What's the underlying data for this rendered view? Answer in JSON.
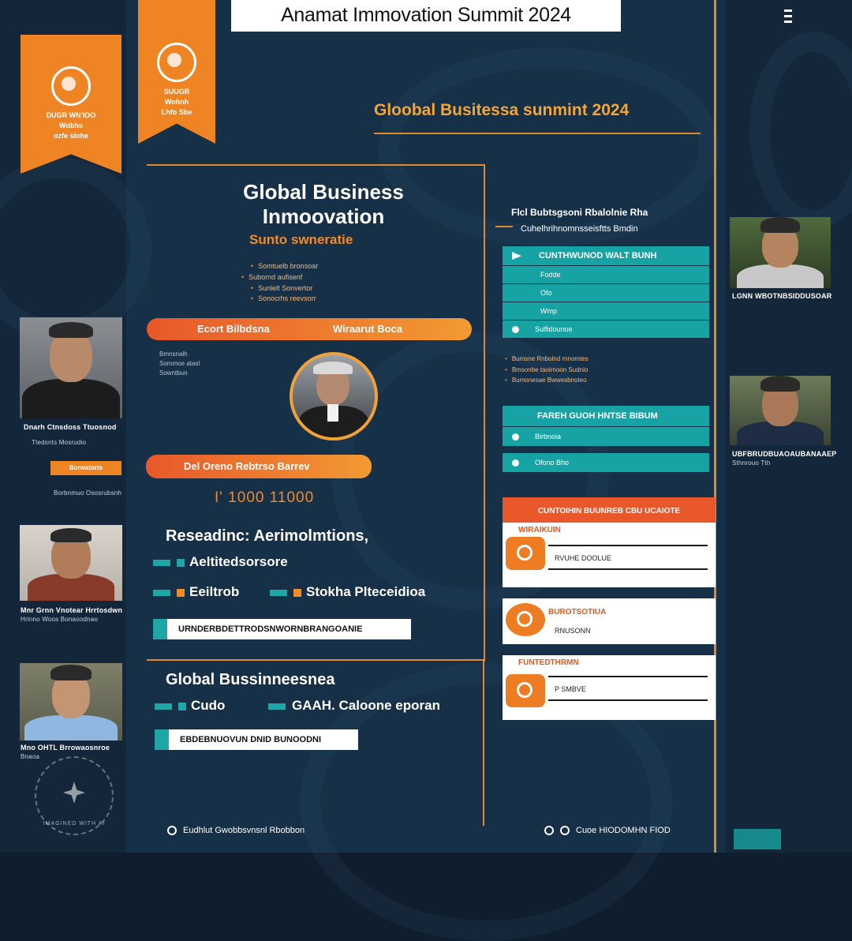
{
  "header": {
    "title": "Anamat Immovation Summit 2024"
  },
  "subtitle": "Gloobal Busitessa sunmint 2024",
  "left_ribbon": {
    "lines": [
      "DUGR WN'IOO",
      "Wdbhs",
      "ozfe   slohe"
    ]
  },
  "top_ribbon": {
    "lines": [
      "SUUGR",
      "Wohnh",
      "Lhfo     Sbe"
    ]
  },
  "main_panel": {
    "title_line1": "Global Business",
    "title_line2": "Inmoovation",
    "tagline": "Sunto swneratie",
    "bullets": [
      "Somtuelb bronsoar",
      "Subornd aufisenf",
      "Sunlelt Sonvertor",
      "Sonocrhs reevsorr"
    ],
    "pill1_left": "Ecort Bilbdsna",
    "pill1_right": "Wiraarut Boca",
    "small_left_lines": [
      "Bmnsnalh",
      "Sommoe atasl",
      "Sowntbun"
    ],
    "pill2": "Del Oreno Rebtrso Barrev",
    "date": "I' 1000 11000",
    "research_heading": "Reseadinc: Aerimolmtions,",
    "tag_arch": "Aeltitedsorsore",
    "tag_estab": "Eeiltrob",
    "tag_stakh": "Stokha Plteceidioa",
    "cta1": "URNDERBDETTRODSNWORNBRANGOANIE",
    "section2_heading": "Global Bussinneesnea",
    "tag_cudo": "Cudo",
    "tag_gaai": "GAAH. Caloone eporan",
    "cta2": "EBDEBNUOVUN DNID BUNOODNI"
  },
  "right_panel": {
    "intro_line1": "Flcl Bubtsgsoni Rbalolnie Rha",
    "intro_line2": "Cuhelhrihnomnsseisftts Bmdin",
    "table1": {
      "header": "CUNTHWUNOD WALT BUNH",
      "rows": [
        "Fodde",
        "Ofo",
        "Wmp",
        "Sulfidounoe"
      ]
    },
    "mid_bullets": [
      "Bumsne Rnbolnd rnnomtes",
      "Bmsonbe taoirnoon Sudnio",
      "Bumonesae Bwwesbnoteo"
    ],
    "table2": {
      "header": "FAREH GUOH HNTSE BIBUM",
      "rows": [
        "Birbnoia",
        "Ofono Bho"
      ]
    },
    "orange_head": "CUNTOIHIN BUUNREB CBU UCAIOTE",
    "cards": [
      {
        "title": "WIRAIKUIN",
        "text": "RVUHE DOOLUE"
      },
      {
        "title": "BUROTSOTIUA",
        "text": "RNUSONN"
      },
      {
        "title": "FUNTEDTHRMN",
        "text": "P SMBVE"
      }
    ]
  },
  "left_speakers": [
    {
      "name": "Dnarh Ctnsdoss Ttuosnod",
      "sub": "Ttedsnts Mosrudio",
      "tag": "Borwatorts",
      "extra": "Borbnmuo  Ososrubsnh"
    },
    {
      "name": "Mnr  Grnn  Vnotear  Hrrtosdwn",
      "sub": "Hrinno   Woos   Bonaoodnao"
    },
    {
      "name": "Mno  OHTL  Brrowaosnroe",
      "sub": "Bnaoa"
    }
  ],
  "right_speakers": [
    {
      "name": "LGNN WBOTNBSIDDUSOAR",
      "sub": ""
    },
    {
      "name": "UBFBRUDBUAOAUBANAAEP",
      "sub": "Sthnrouo  Tth"
    }
  ],
  "footer": {
    "left": "Eudhlut Gwobbsvnsnl Rbobbon",
    "right": "Cuoe HIODOMHN FIOD"
  },
  "watermark": "IMAGINED WITH AI",
  "colors": {
    "accent": "#ef8424",
    "teal": "#17a3a3",
    "background": "#0f1e2e",
    "panel": "#163048"
  }
}
